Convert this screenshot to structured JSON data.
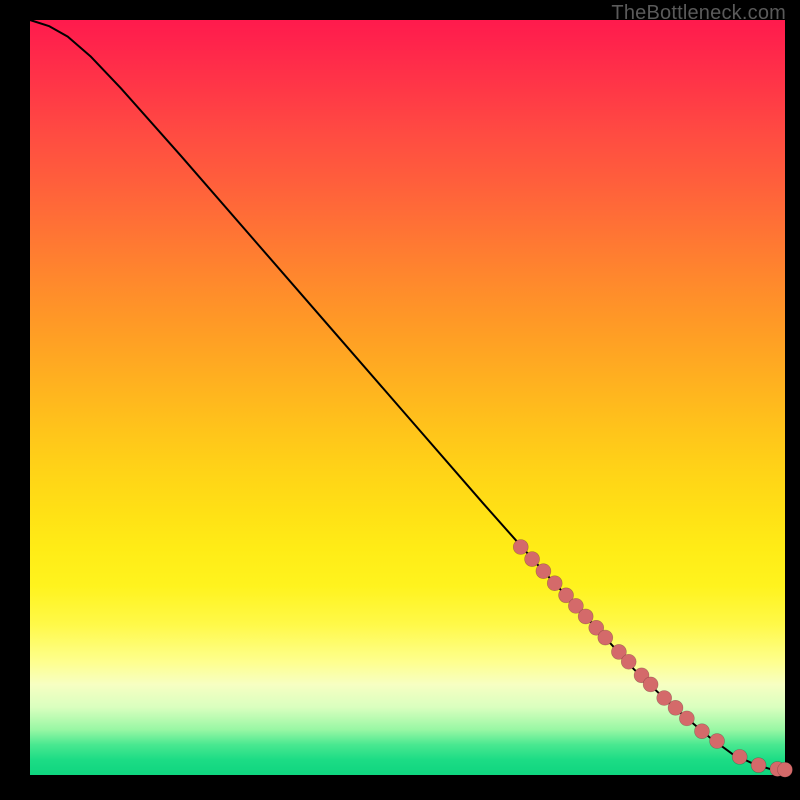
{
  "watermark": "TheBottleneck.com",
  "colors": {
    "marker_fill": "#d46a6a",
    "line_stroke": "#000000",
    "frame_bg": "#000000"
  },
  "chart_data": {
    "type": "line",
    "title": "",
    "xlabel": "",
    "ylabel": "",
    "xlim": [
      0,
      100
    ],
    "ylim": [
      0,
      100
    ],
    "grid": false,
    "legend": false,
    "series": [
      {
        "name": "bottleneck-curve",
        "x": [
          0,
          2.5,
          5,
          8,
          12,
          20,
          30,
          40,
          50,
          60,
          68,
          75,
          80,
          85,
          90,
          93,
          96,
          98,
          100
        ],
        "y": [
          100,
          99.2,
          97.8,
          95.2,
          91.0,
          82.0,
          70.5,
          59.0,
          47.5,
          36.0,
          27.0,
          19.5,
          14.0,
          9.2,
          5.0,
          2.8,
          1.4,
          0.8,
          0.7
        ]
      }
    ],
    "highlighted_points": {
      "name": "dense-tail-markers",
      "x": [
        65,
        66.5,
        68,
        69.5,
        71,
        72.3,
        73.6,
        75,
        76.2,
        78,
        79.3,
        81,
        82.2,
        84,
        85.5,
        87,
        89,
        91,
        94,
        96.5,
        99,
        100
      ],
      "y": [
        30.2,
        28.6,
        27.0,
        25.4,
        23.8,
        22.4,
        21.0,
        19.5,
        18.2,
        16.3,
        15.0,
        13.2,
        12.0,
        10.2,
        8.9,
        7.5,
        5.8,
        4.5,
        2.4,
        1.3,
        0.8,
        0.7
      ]
    }
  }
}
